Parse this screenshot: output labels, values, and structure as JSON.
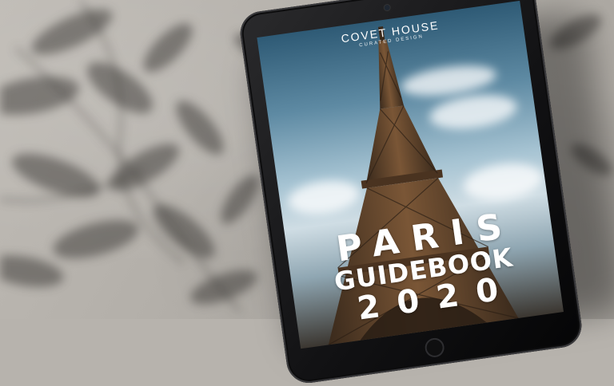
{
  "brand": {
    "name": "COVET HOUSE",
    "subtitle": "CURATED DESIGN"
  },
  "cover": {
    "title": "PARIS",
    "subtitle": "GUIDEBOOK",
    "year": "2020"
  },
  "icons": {
    "landmark": "eiffel-tower",
    "device": "tablet"
  },
  "colors": {
    "wall": "#b7b3ad",
    "sky": "#5e8aa3",
    "tower": "#5a3e26",
    "text": "#ffffff",
    "bezel": "#111113"
  }
}
